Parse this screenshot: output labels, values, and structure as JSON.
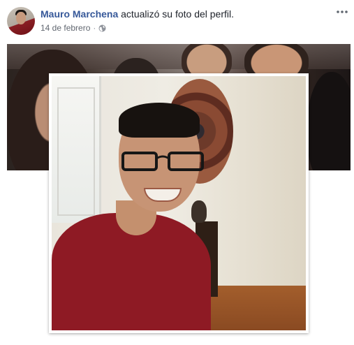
{
  "post": {
    "author_name": "Mauro Marchena",
    "action_text": "actualizó su foto del perfil.",
    "date": "14 de febrero",
    "separator": "·",
    "privacy_icon": "globe-icon",
    "more_icon": "more-options-icon"
  },
  "colors": {
    "author_link": "#365899",
    "meta_text": "#616770",
    "shirt": "#8e1a24"
  }
}
